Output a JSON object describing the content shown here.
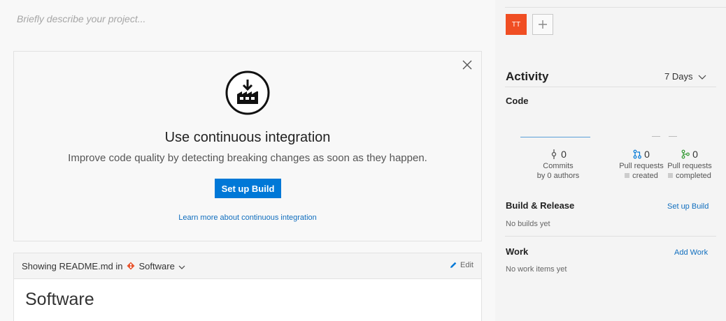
{
  "project": {
    "description_placeholder": "Briefly describe your project..."
  },
  "ci_card": {
    "title": "Use continuous integration",
    "subtitle": "Improve code quality by detecting breaking changes as soon as they happen.",
    "button_label": "Set up Build",
    "learn_more_link": "Learn more about continuous integration"
  },
  "readme": {
    "showing_prefix": "Showing README.md in",
    "repo_name": "Software",
    "edit_label": "Edit",
    "heading": "Software"
  },
  "members": {
    "avatar_initials": "TT",
    "avatar_color": "#f04e23"
  },
  "activity": {
    "title": "Activity",
    "range_label": "7 Days",
    "code": {
      "label": "Code",
      "commits_count": "0",
      "commits_label": "Commits",
      "commits_sub": "by 0 authors",
      "pr_created_count": "0",
      "pr_created_label": "Pull requests",
      "pr_created_sub": "created",
      "pr_completed_count": "0",
      "pr_completed_label": "Pull requests",
      "pr_completed_sub": "completed"
    },
    "build_release": {
      "label": "Build & Release",
      "action_label": "Set up Build",
      "empty_text": "No builds yet"
    },
    "work": {
      "label": "Work",
      "action_label": "Add Work",
      "empty_text": "No work items yet"
    }
  },
  "colors": {
    "accent": "#0078d7",
    "link": "#106ebe",
    "pr_icon": "#0078d7",
    "pr_completed_icon": "#339933"
  },
  "icons": [
    "close-icon",
    "build-factory-icon",
    "git-icon",
    "chevron-down-icon",
    "pencil-icon",
    "plus-icon",
    "commit-icon",
    "pull-request-icon"
  ]
}
